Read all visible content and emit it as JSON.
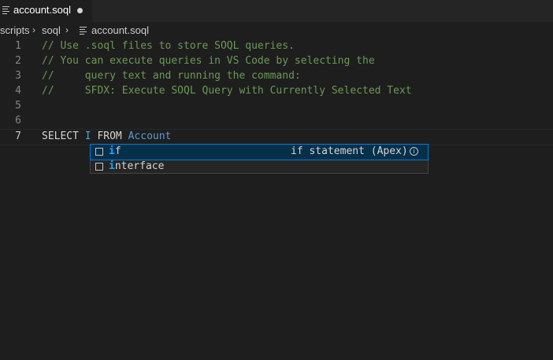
{
  "tab": {
    "label": "account.soql",
    "dirty": true
  },
  "breadcrumb": {
    "segments": [
      "scripts",
      "soql",
      "account.soql"
    ]
  },
  "editor": {
    "lines": [
      {
        "number": "1",
        "text": "// Use .soql files to store SOQL queries."
      },
      {
        "number": "2",
        "text": "// You can execute queries in VS Code by selecting the"
      },
      {
        "number": "3",
        "text": "//     query text and running the command:"
      },
      {
        "number": "4",
        "text": "//     SFDX: Execute SOQL Query with Currently Selected Text"
      },
      {
        "number": "5",
        "text": ""
      },
      {
        "number": "6",
        "text": ""
      },
      {
        "number": "7",
        "select": "SELECT",
        "field": "I",
        "from": "FROM",
        "object": "Account"
      }
    ]
  },
  "suggestions": {
    "items": [
      {
        "match": "i",
        "rest": "f",
        "detail": "if statement (Apex)",
        "selected": true
      },
      {
        "match": "i",
        "rest": "nterface",
        "detail": "",
        "selected": false
      }
    ],
    "info_icon": "info-icon"
  },
  "colors": {
    "comment": "#6a9955",
    "keyword": "#d4d4d4",
    "identifier": "#569cd6",
    "match_highlight": "#18a3ff",
    "selection_bg": "#062f4a"
  }
}
